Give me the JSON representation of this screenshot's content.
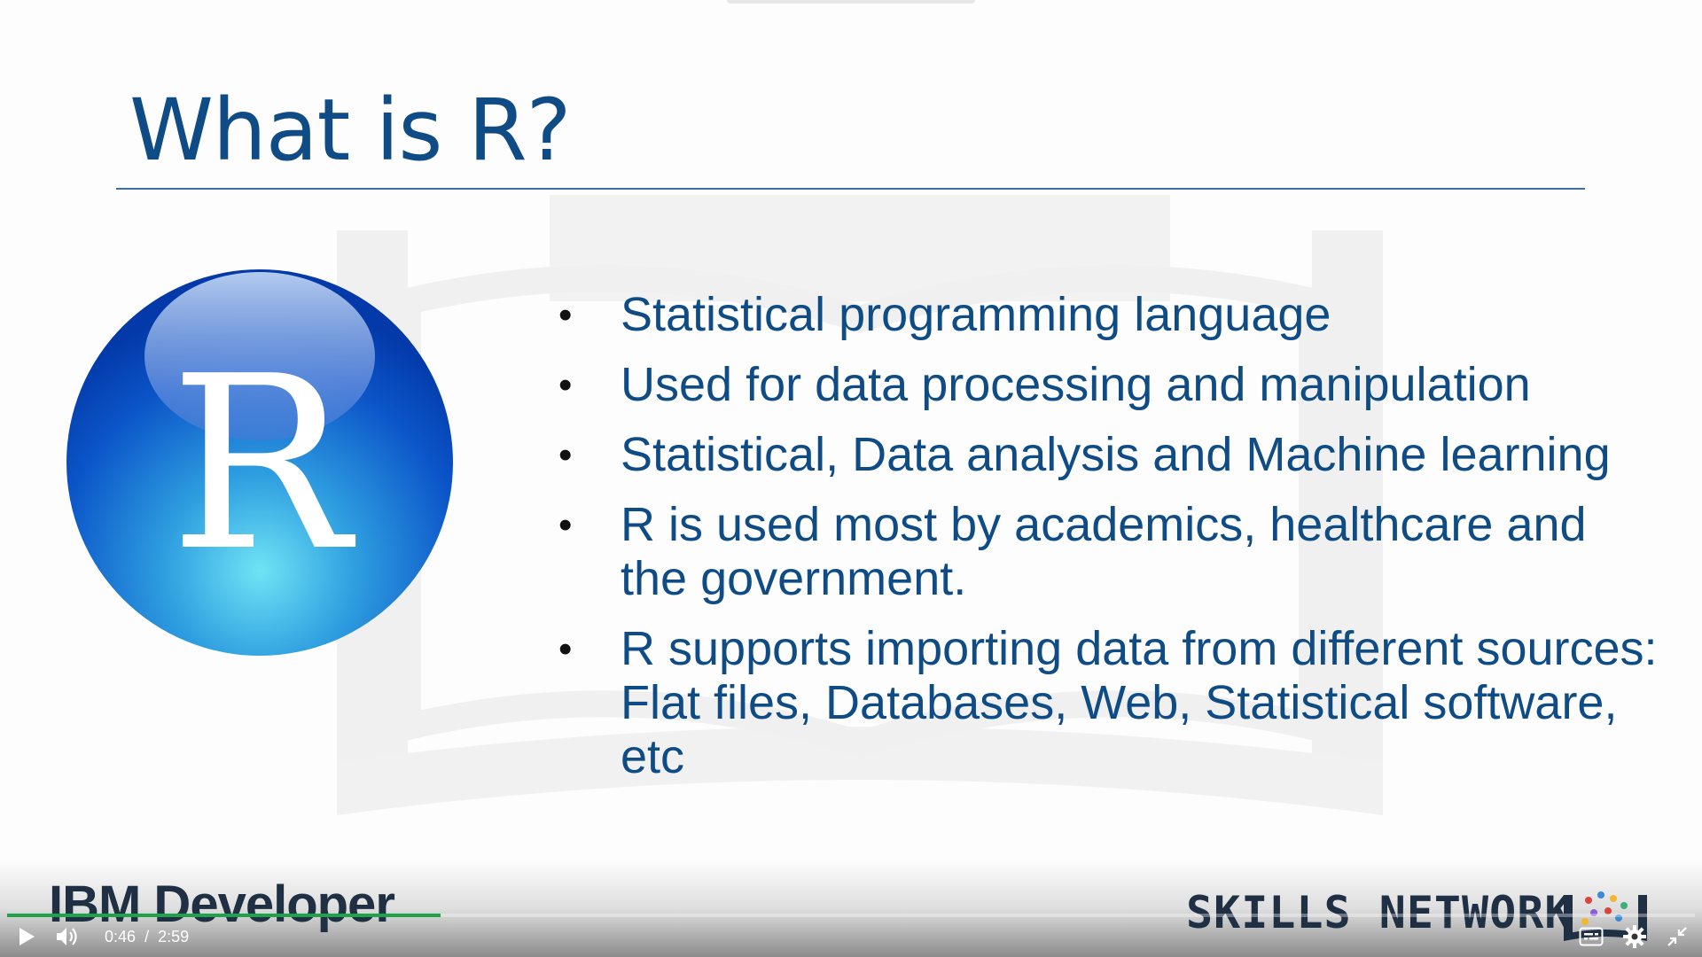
{
  "slide": {
    "title": "What is R?",
    "logo_letter": "R",
    "bullets": [
      "Statistical programming language",
      "Used for data processing and manipulation",
      "Statistical, Data analysis and Machine learning",
      "R is used most by academics, healthcare and the government.",
      "R supports importing data from different sources: Flat files, Databases, Web, Statistical software, etc"
    ],
    "bullet_glyph": "•"
  },
  "branding": {
    "left": "IBM Developer",
    "right": "SKILLS NETWORK"
  },
  "player": {
    "current_time": "0:46",
    "separator": "/",
    "duration": "2:59",
    "progress_fraction": 0.257,
    "icons": {
      "play": "play-icon",
      "volume": "volume-icon",
      "captions": "captions-icon",
      "settings": "gear-icon",
      "fullscreen": "exit-fullscreen-icon"
    }
  },
  "colors": {
    "title": "#0f4c86",
    "rule": "#3b6fa8",
    "progress": "#1fa34a"
  }
}
